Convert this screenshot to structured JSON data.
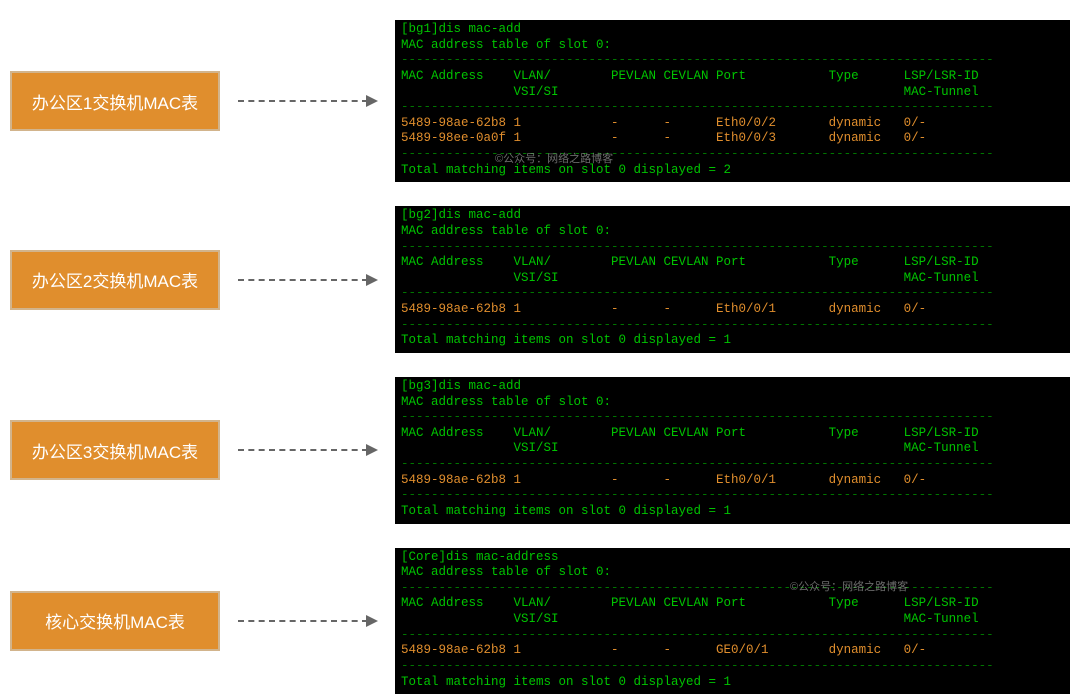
{
  "rows": [
    {
      "label": "办公区1交换机MAC表",
      "prompt": "[bg1]",
      "cmd": "dis mac-add",
      "header": "MAC address table of slot 0:",
      "cols": {
        "c1": "MAC Address",
        "c2": "VLAN/",
        "c2b": "VSI/SI",
        "c3": "PEVLAN",
        "c4": "CEVLAN",
        "c5": "Port",
        "c6": "Type",
        "c7": "LSP/LSR-ID",
        "c7b": "MAC-Tunnel"
      },
      "entries": [
        {
          "mac": "5489-98ae-62b8",
          "vlan": "1",
          "pev": "-",
          "cev": "-",
          "port": "Eth0/0/2",
          "type": "dynamic",
          "lsp": "0/-"
        },
        {
          "mac": "5489-98ee-0a0f",
          "vlan": "1",
          "pev": "-",
          "cev": "-",
          "port": "Eth0/0/3",
          "type": "dynamic",
          "lsp": "0/-"
        }
      ],
      "footer": "Total matching items on slot 0 displayed = 2"
    },
    {
      "label": "办公区2交换机MAC表",
      "prompt": "[bg2]",
      "cmd": "dis mac-add",
      "header": "MAC address table of slot 0:",
      "cols": {
        "c1": "MAC Address",
        "c2": "VLAN/",
        "c2b": "VSI/SI",
        "c3": "PEVLAN",
        "c4": "CEVLAN",
        "c5": "Port",
        "c6": "Type",
        "c7": "LSP/LSR-ID",
        "c7b": "MAC-Tunnel"
      },
      "entries": [
        {
          "mac": "5489-98ae-62b8",
          "vlan": "1",
          "pev": "-",
          "cev": "-",
          "port": "Eth0/0/1",
          "type": "dynamic",
          "lsp": "0/-"
        }
      ],
      "footer": "Total matching items on slot 0 displayed = 1"
    },
    {
      "label": "办公区3交换机MAC表",
      "prompt": "[bg3]",
      "cmd": "dis mac-add",
      "header": "MAC address table of slot 0:",
      "cols": {
        "c1": "MAC Address",
        "c2": "VLAN/",
        "c2b": "VSI/SI",
        "c3": "PEVLAN",
        "c4": "CEVLAN",
        "c5": "Port",
        "c6": "Type",
        "c7": "LSP/LSR-ID",
        "c7b": "MAC-Tunnel"
      },
      "entries": [
        {
          "mac": "5489-98ae-62b8",
          "vlan": "1",
          "pev": "-",
          "cev": "-",
          "port": "Eth0/0/1",
          "type": "dynamic",
          "lsp": "0/-"
        }
      ],
      "footer": "Total matching items on slot 0 displayed = 1"
    },
    {
      "label": "核心交换机MAC表",
      "prompt": "[Core]",
      "cmd": "dis mac-address",
      "header": "MAC address table of slot 0:",
      "cols": {
        "c1": "MAC Address",
        "c2": "VLAN/",
        "c2b": "VSI/SI",
        "c3": "PEVLAN",
        "c4": "CEVLAN",
        "c5": "Port",
        "c6": "Type",
        "c7": "LSP/LSR-ID",
        "c7b": "MAC-Tunnel"
      },
      "entries": [
        {
          "mac": "5489-98ae-62b8",
          "vlan": "1",
          "pev": "-",
          "cev": "-",
          "port": "GE0/0/1",
          "type": "dynamic",
          "lsp": "0/-"
        }
      ],
      "footer": "Total matching items on slot 0 displayed = 1"
    }
  ],
  "watermark": "©公众号：网络之路博客",
  "dashline": "-------------------------------------------------------------------------------"
}
